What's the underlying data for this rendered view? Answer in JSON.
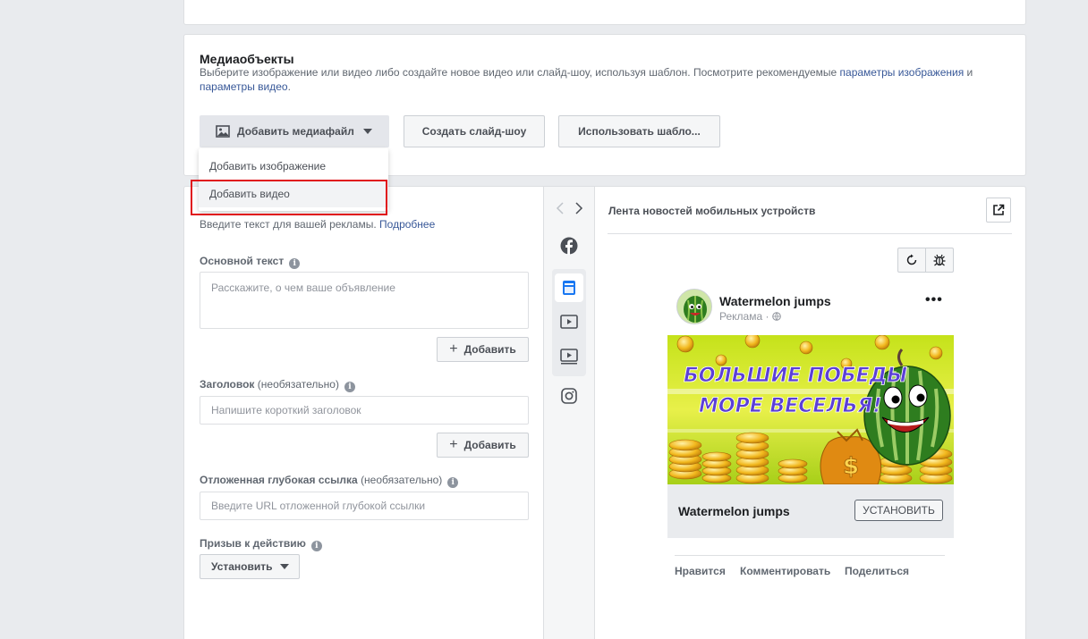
{
  "media": {
    "title": "Медиаобъекты",
    "description": "Выберите изображение или видео либо создайте новое видео или слайд-шоу, используя шаблон. Посмотрите рекомендуемые ",
    "link_image_params": "параметры изображения",
    "and": " и",
    "link_video_params": "параметры видео",
    "period": ".",
    "buttons": {
      "add_media": "Добавить медиафайл",
      "create_slideshow": "Создать слайд-шоу",
      "use_template": "Использовать шабло..."
    },
    "dropdown": {
      "add_image": "Добавить изображение",
      "add_video": "Добавить видео"
    }
  },
  "text_section": {
    "hint": "Введите текст для вашей рекламы. ",
    "hint_link": "Подробнее",
    "primary_text_label": "Основной текст",
    "primary_text_placeholder": "Расскажите, о чем ваше объявление",
    "add_label": "Добавить",
    "headline_label": "Заголовок",
    "optional": "(необязательно)",
    "headline_placeholder": "Напишите короткий заголовок",
    "deeplink_label": "Отложенная глубокая ссылка",
    "deeplink_placeholder": "Введите URL отложенной глубокой ссылки",
    "cta_label": "Призыв к действию",
    "cta_value": "Установить"
  },
  "preview": {
    "title": "Лента новостей мобильных устройств",
    "page_name": "Watermelon jumps",
    "sponsored": "Реклама · ",
    "ad_text_line1": "БОЛЬШИЕ ПОБЕДЫ",
    "ad_text_line2": "МОРЕ ВЕСЕЛЬЯ!",
    "cta_title": "Watermelon jumps",
    "cta_button": "УСТАНОВИТЬ",
    "actions": {
      "like": "Нравится",
      "comment": "Комментировать",
      "share": "Поделиться"
    }
  },
  "colors": {
    "link": "#385898",
    "highlight": "#e0141c",
    "selected_rail": "#1877f2"
  }
}
